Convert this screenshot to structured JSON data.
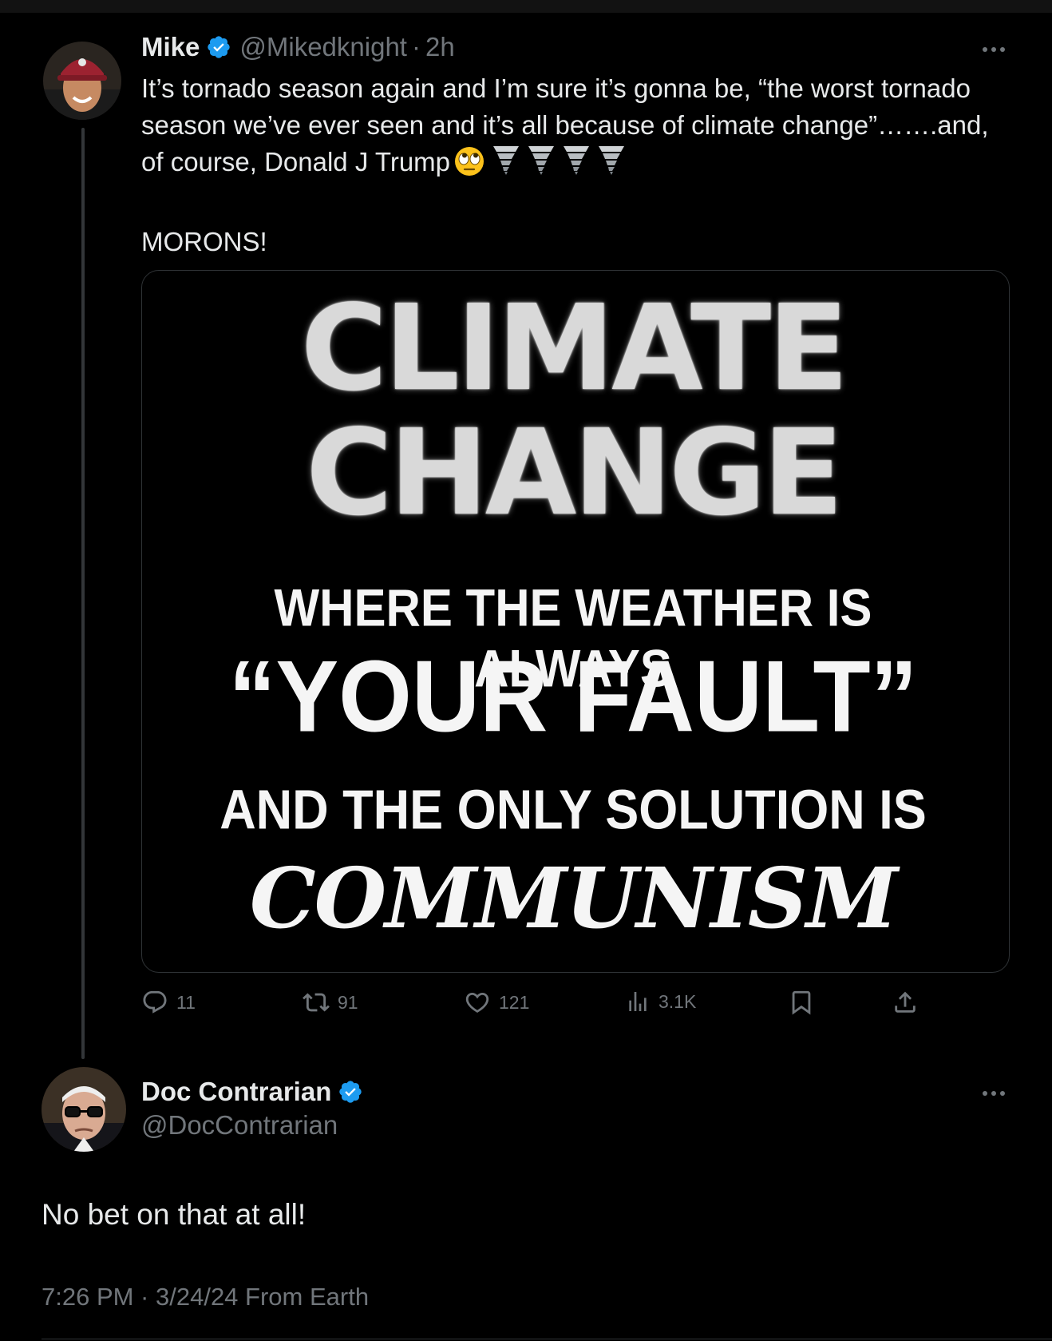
{
  "post": {
    "author_name": "Mike",
    "handle": "@Mikedknight",
    "separator": "·",
    "time": "2h",
    "text_line1": "It’s tornado season again and I’m sure it’s gonna be, “the worst tornado",
    "text_line2": "season we’ve ever seen and it’s all because of climate change”…….and,",
    "text_line3": "of course, Donald J Trump",
    "text_line4": "MORONS!",
    "emoji": "face-with-rolling-eyes",
    "tornado_count": 4,
    "image": {
      "line1": "CLIMATE",
      "line2": "CHANGE",
      "line3": "WHERE THE WEATHER IS ALWAYS",
      "line4": "“YOUR FAULT”",
      "line5": "AND THE ONLY SOLUTION IS",
      "line6": "COMMUNISM"
    },
    "actions": {
      "replies": "11",
      "reposts": "91",
      "likes": "121",
      "views": "3.1K"
    }
  },
  "reply": {
    "author_name": "Doc Contrarian",
    "handle": "@DocContrarian",
    "text": "No bet on that at all!",
    "timestamp": "7:26 PM · 3/24/24 From Earth"
  },
  "colors": {
    "background": "#000000",
    "text": "#e7e9ea",
    "muted": "#71767b",
    "verified": "#1d9bf0",
    "border": "#2f3336"
  }
}
